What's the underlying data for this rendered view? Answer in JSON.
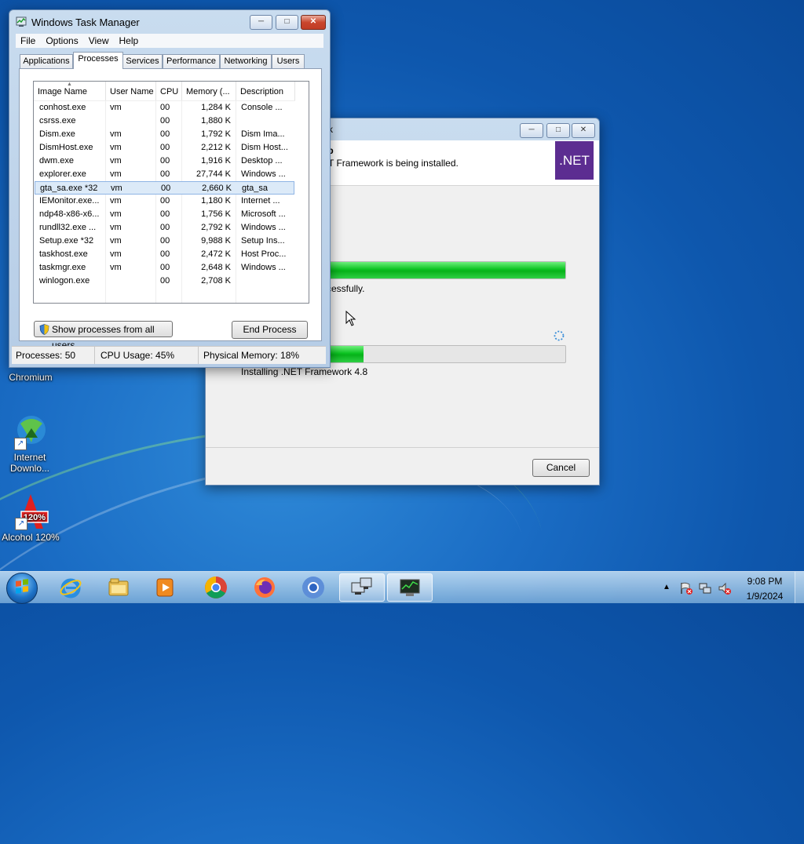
{
  "desktop": {
    "icons": [
      {
        "label": "Chromium"
      },
      {
        "label": "Internet Downlo..."
      },
      {
        "label": "Alcohol 120%"
      }
    ]
  },
  "net_setup": {
    "title_partial": "k",
    "header_title_partial": "up",
    "header_subtitle": "ET Framework is being installed.",
    "logo_text": ".NET",
    "status1_partial": "ccessfully.",
    "progress1": 1.0,
    "progress2": 0.17,
    "status2": "Installing .NET Framework 4.8",
    "cancel_label": "Cancel"
  },
  "task_manager": {
    "title": "Windows Task Manager",
    "menu": [
      "File",
      "Options",
      "View",
      "Help"
    ],
    "tabs": [
      "Applications",
      "Processes",
      "Services",
      "Performance",
      "Networking",
      "Users"
    ],
    "active_tab": "Processes",
    "columns": [
      "Image Name",
      "User Name",
      "CPU",
      "Memory (...",
      "Description"
    ],
    "processes": [
      {
        "name": "conhost.exe",
        "user": "vm",
        "cpu": "00",
        "mem": "1,284 K",
        "desc": "Console ..."
      },
      {
        "name": "csrss.exe",
        "user": "",
        "cpu": "00",
        "mem": "1,880 K",
        "desc": ""
      },
      {
        "name": "Dism.exe",
        "user": "vm",
        "cpu": "00",
        "mem": "1,792 K",
        "desc": "Dism Ima..."
      },
      {
        "name": "DismHost.exe",
        "user": "vm",
        "cpu": "00",
        "mem": "2,212 K",
        "desc": "Dism Host..."
      },
      {
        "name": "dwm.exe",
        "user": "vm",
        "cpu": "00",
        "mem": "1,916 K",
        "desc": "Desktop ..."
      },
      {
        "name": "explorer.exe",
        "user": "vm",
        "cpu": "00",
        "mem": "27,744 K",
        "desc": "Windows ..."
      },
      {
        "name": "gta_sa.exe *32",
        "user": "vm",
        "cpu": "00",
        "mem": "2,660 K",
        "desc": "gta_sa",
        "selected": true
      },
      {
        "name": "IEMonitor.exe...",
        "user": "vm",
        "cpu": "00",
        "mem": "1,180 K",
        "desc": "Internet ..."
      },
      {
        "name": "ndp48-x86-x6...",
        "user": "vm",
        "cpu": "00",
        "mem": "1,756 K",
        "desc": "Microsoft ..."
      },
      {
        "name": "rundll32.exe ...",
        "user": "vm",
        "cpu": "00",
        "mem": "2,792 K",
        "desc": "Windows ..."
      },
      {
        "name": "Setup.exe *32",
        "user": "vm",
        "cpu": "00",
        "mem": "9,988 K",
        "desc": "Setup Ins..."
      },
      {
        "name": "taskhost.exe",
        "user": "vm",
        "cpu": "00",
        "mem": "2,472 K",
        "desc": "Host Proc..."
      },
      {
        "name": "taskmgr.exe",
        "user": "vm",
        "cpu": "00",
        "mem": "2,648 K",
        "desc": "Windows ..."
      },
      {
        "name": "winlogon.exe",
        "user": "",
        "cpu": "00",
        "mem": "2,708 K",
        "desc": ""
      }
    ],
    "show_all_label": "Show processes from all users",
    "end_process_label": "End Process",
    "status": {
      "processes": "Processes: 50",
      "cpu": "CPU Usage: 45%",
      "memory": "Physical Memory: 18%"
    }
  },
  "taskbar": {
    "items": [
      {
        "icon": "internet-explorer-icon"
      },
      {
        "icon": "file-explorer-icon"
      },
      {
        "icon": "media-player-icon"
      },
      {
        "icon": "chrome-icon"
      },
      {
        "icon": "firefox-icon"
      },
      {
        "icon": "chromium-icon"
      },
      {
        "icon": "network-setup-icon",
        "active": true
      },
      {
        "icon": "task-manager-icon",
        "active": true
      }
    ],
    "clock": {
      "time": "9:08 PM",
      "date": "1/9/2024"
    }
  }
}
